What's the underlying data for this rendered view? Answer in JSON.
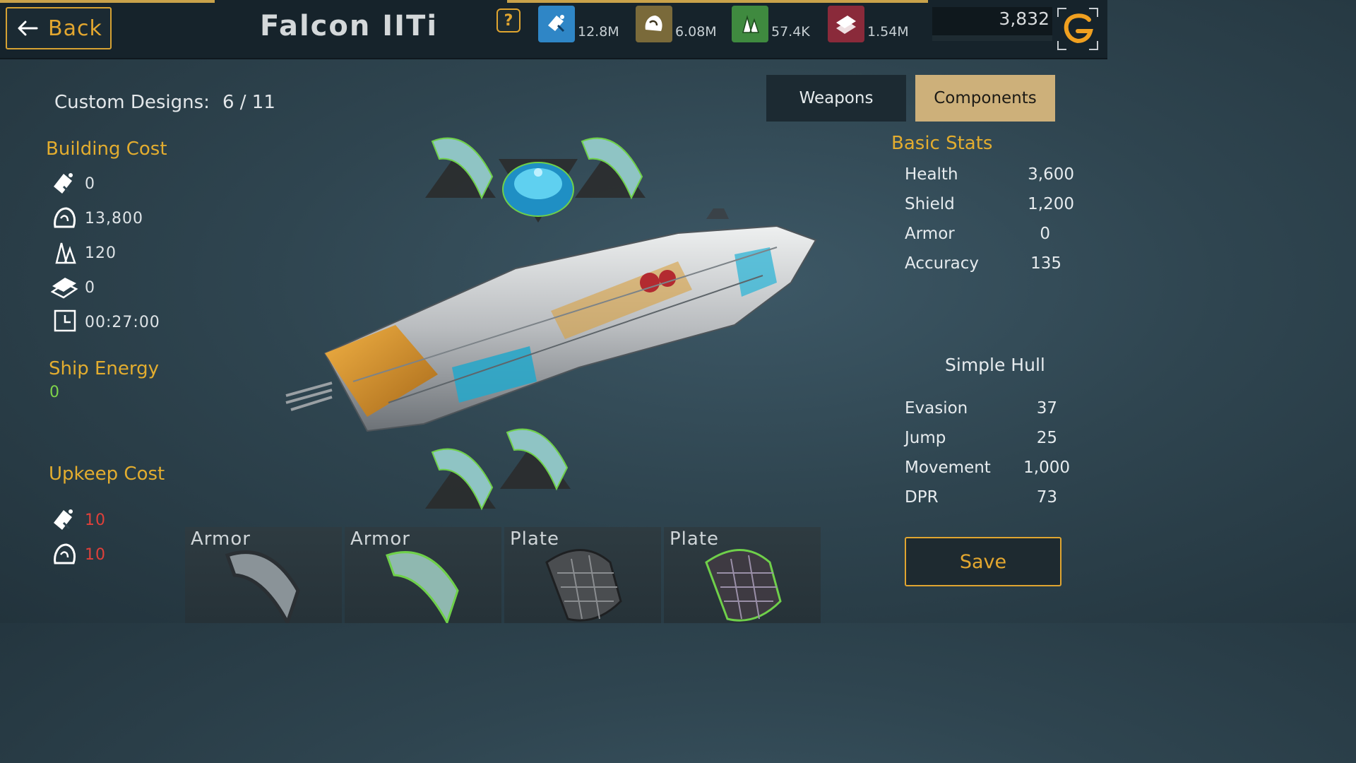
{
  "header": {
    "back_label": "Back",
    "ship_name": "Falcon IITi",
    "help_label": "?",
    "resources": [
      {
        "icon": "energy-fuel-icon",
        "value": "12.8M",
        "color": "#2f86c6"
      },
      {
        "icon": "ore-icon",
        "value": "6.08M",
        "color": "#7a6a3a"
      },
      {
        "icon": "crystal-icon",
        "value": "57.4K",
        "color": "#3f8a3f"
      },
      {
        "icon": "alloy-icon",
        "value": "1.54M",
        "color": "#8a2a3a"
      }
    ],
    "premium_currency": "3,832"
  },
  "left": {
    "custom_designs_label": "Custom Designs:",
    "custom_designs_count": "6 / 11",
    "building_cost_title": "Building Cost",
    "building_cost": [
      {
        "icon": "fuel-icon",
        "value": "0"
      },
      {
        "icon": "ore-icon",
        "value": "13,800"
      },
      {
        "icon": "crystal-icon",
        "value": "120"
      },
      {
        "icon": "alloy-icon",
        "value": "0"
      },
      {
        "icon": "clock-icon",
        "value": "00:27:00"
      }
    ],
    "ship_energy_title": "Ship Energy",
    "ship_energy_value": "0",
    "upkeep_title": "Upkeep Cost",
    "upkeep": [
      {
        "icon": "fuel-icon",
        "value": "10"
      },
      {
        "icon": "ore-icon",
        "value": "10"
      }
    ]
  },
  "tabs": {
    "weapons": "Weapons",
    "components": "Components",
    "active": "Components"
  },
  "stats": {
    "title": "Basic Stats",
    "basic": [
      {
        "label": "Health",
        "value": "3,600"
      },
      {
        "label": "Shield",
        "value": "1,200"
      },
      {
        "label": "Armor",
        "value": "0"
      },
      {
        "label": "Accuracy",
        "value": "135"
      }
    ],
    "hull_title": "Simple Hull",
    "hull": [
      {
        "label": "Evasion",
        "value": "37"
      },
      {
        "label": "Jump",
        "value": "25"
      },
      {
        "label": "Movement",
        "value": "1,000"
      },
      {
        "label": "DPR",
        "value": "73"
      }
    ],
    "save_label": "Save"
  },
  "tray": [
    {
      "label": "Armor",
      "kind": "armor-plain",
      "icon": "armor-plate-icon"
    },
    {
      "label": "Armor",
      "kind": "armor-green",
      "icon": "armor-plate-icon"
    },
    {
      "label": "Plate",
      "kind": "plate-grey",
      "icon": "hex-plate-icon"
    },
    {
      "label": "Plate",
      "kind": "plate-green",
      "icon": "hex-plate-icon"
    }
  ],
  "colors": {
    "accent_gold": "#e3ad2f",
    "tab_active": "#cdb07a",
    "upkeep_red": "#e0403a",
    "energy_green": "#7fd34a"
  }
}
